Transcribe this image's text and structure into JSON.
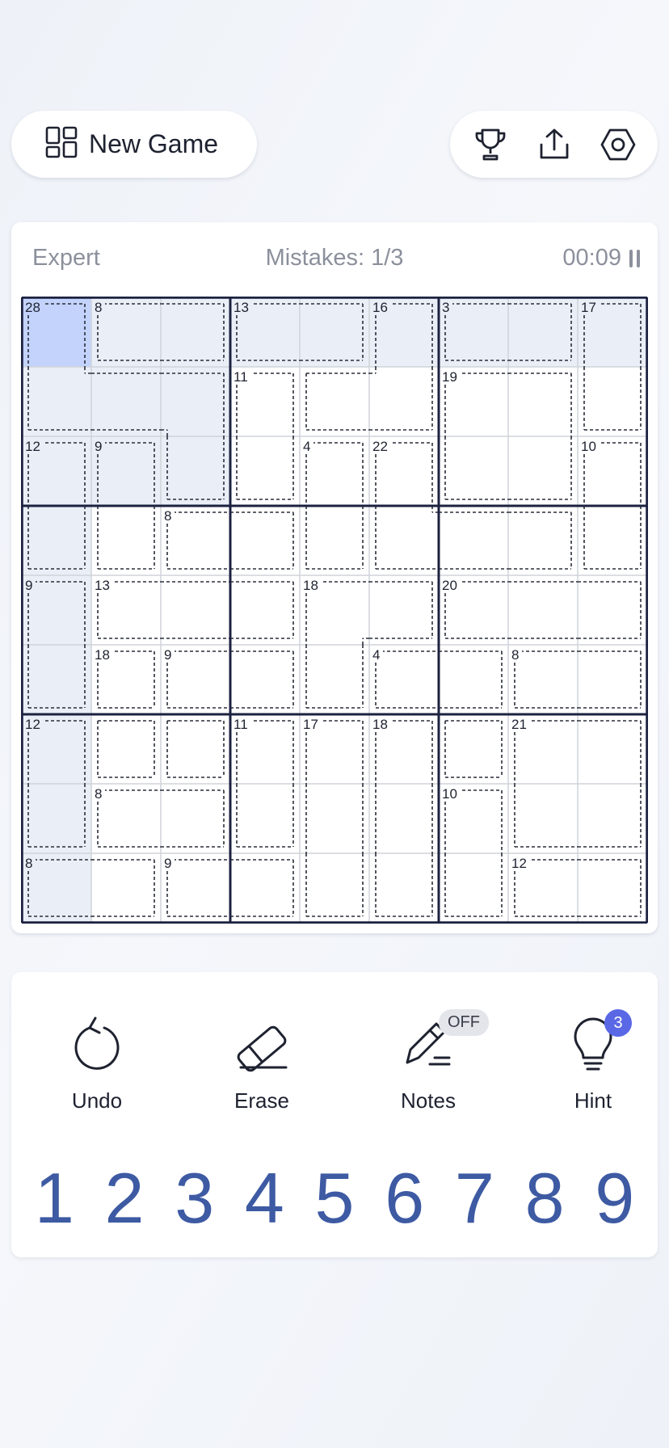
{
  "header": {
    "new_game_label": "New Game",
    "icons": [
      "grid-icon",
      "trophy-icon",
      "share-icon",
      "settings-icon"
    ]
  },
  "status": {
    "difficulty": "Expert",
    "mistakes": "Mistakes: 1/3",
    "timer": "00:09"
  },
  "board": {
    "selected_cell": [
      0,
      0
    ],
    "cages": [
      {
        "sum": 28,
        "cells": [
          [
            0,
            0
          ],
          [
            1,
            0
          ],
          [
            1,
            1
          ],
          [
            1,
            2
          ],
          [
            2,
            2
          ]
        ]
      },
      {
        "sum": 8,
        "cells": [
          [
            0,
            1
          ],
          [
            0,
            2
          ]
        ]
      },
      {
        "sum": 13,
        "cells": [
          [
            0,
            3
          ],
          [
            0,
            4
          ]
        ]
      },
      {
        "sum": 16,
        "cells": [
          [
            0,
            5
          ],
          [
            1,
            4
          ],
          [
            1,
            5
          ]
        ]
      },
      {
        "sum": 3,
        "cells": [
          [
            0,
            6
          ],
          [
            0,
            7
          ]
        ]
      },
      {
        "sum": 17,
        "cells": [
          [
            0,
            8
          ],
          [
            1,
            8
          ]
        ]
      },
      {
        "sum": 11,
        "cells": [
          [
            1,
            3
          ],
          [
            2,
            3
          ]
        ]
      },
      {
        "sum": 19,
        "cells": [
          [
            1,
            6
          ],
          [
            1,
            7
          ],
          [
            2,
            6
          ],
          [
            2,
            7
          ]
        ]
      },
      {
        "sum": 12,
        "cells": [
          [
            2,
            0
          ],
          [
            3,
            0
          ]
        ]
      },
      {
        "sum": 9,
        "cells": [
          [
            2,
            1
          ],
          [
            3,
            1
          ]
        ]
      },
      {
        "sum": 4,
        "cells": [
          [
            2,
            4
          ],
          [
            3,
            4
          ]
        ]
      },
      {
        "sum": 22,
        "cells": [
          [
            2,
            5
          ],
          [
            3,
            5
          ],
          [
            3,
            6
          ],
          [
            3,
            7
          ]
        ]
      },
      {
        "sum": 10,
        "cells": [
          [
            2,
            8
          ],
          [
            3,
            8
          ]
        ]
      },
      {
        "sum": 8,
        "cells": [
          [
            3,
            2
          ],
          [
            3,
            3
          ]
        ]
      },
      {
        "sum": 9,
        "cells": [
          [
            4,
            0
          ],
          [
            5,
            0
          ]
        ]
      },
      {
        "sum": 13,
        "cells": [
          [
            4,
            1
          ],
          [
            4,
            2
          ],
          [
            4,
            3
          ]
        ]
      },
      {
        "sum": 18,
        "cells": [
          [
            4,
            4
          ],
          [
            4,
            5
          ],
          [
            5,
            4
          ]
        ]
      },
      {
        "sum": 20,
        "cells": [
          [
            4,
            6
          ],
          [
            4,
            7
          ],
          [
            4,
            8
          ]
        ]
      },
      {
        "sum": 18,
        "cells": [
          [
            5,
            1
          ],
          [
            6,
            2
          ]
        ]
      },
      {
        "sum": 9,
        "cells": [
          [
            5,
            2
          ],
          [
            5,
            3
          ]
        ]
      },
      {
        "sum": 4,
        "cells": [
          [
            5,
            5
          ],
          [
            5,
            6
          ]
        ]
      },
      {
        "sum": 8,
        "cells": [
          [
            5,
            7
          ],
          [
            5,
            8
          ]
        ]
      },
      {
        "sum": 12,
        "cells": [
          [
            6,
            0
          ],
          [
            7,
            0
          ]
        ]
      },
      {
        "sum": 11,
        "cells": [
          [
            6,
            3
          ],
          [
            7,
            3
          ]
        ]
      },
      {
        "sum": 17,
        "cells": [
          [
            6,
            4
          ],
          [
            7,
            4
          ],
          [
            8,
            4
          ]
        ]
      },
      {
        "sum": 18,
        "cells": [
          [
            6,
            5
          ],
          [
            7,
            5
          ],
          [
            8,
            5
          ]
        ]
      },
      {
        "sum": 21,
        "cells": [
          [
            6,
            7
          ],
          [
            6,
            8
          ],
          [
            7,
            7
          ],
          [
            7,
            8
          ]
        ]
      },
      {
        "sum": 8,
        "cells": [
          [
            7,
            1
          ],
          [
            7,
            2
          ]
        ]
      },
      {
        "sum": 10,
        "cells": [
          [
            7,
            6
          ],
          [
            8,
            6
          ]
        ]
      },
      {
        "sum": 8,
        "cells": [
          [
            8,
            0
          ],
          [
            8,
            1
          ]
        ]
      },
      {
        "sum": 9,
        "cells": [
          [
            8,
            2
          ],
          [
            8,
            3
          ]
        ]
      },
      {
        "sum": 12,
        "cells": [
          [
            8,
            7
          ],
          [
            8,
            8
          ]
        ]
      }
    ]
  },
  "tools": {
    "undo_label": "Undo",
    "erase_label": "Erase",
    "notes_label": "Notes",
    "notes_state": "OFF",
    "hint_label": "Hint",
    "hint_count": "3"
  },
  "numpad": [
    "1",
    "2",
    "3",
    "4",
    "5",
    "6",
    "7",
    "8",
    "9"
  ],
  "colors": {
    "selected": "#c3d3fc",
    "related": "#eaeef6",
    "grid_thick": "#1c2240",
    "grid_thin": "#d0d3da",
    "number": "#3d5aa3",
    "hint_badge": "#5a68e6"
  }
}
